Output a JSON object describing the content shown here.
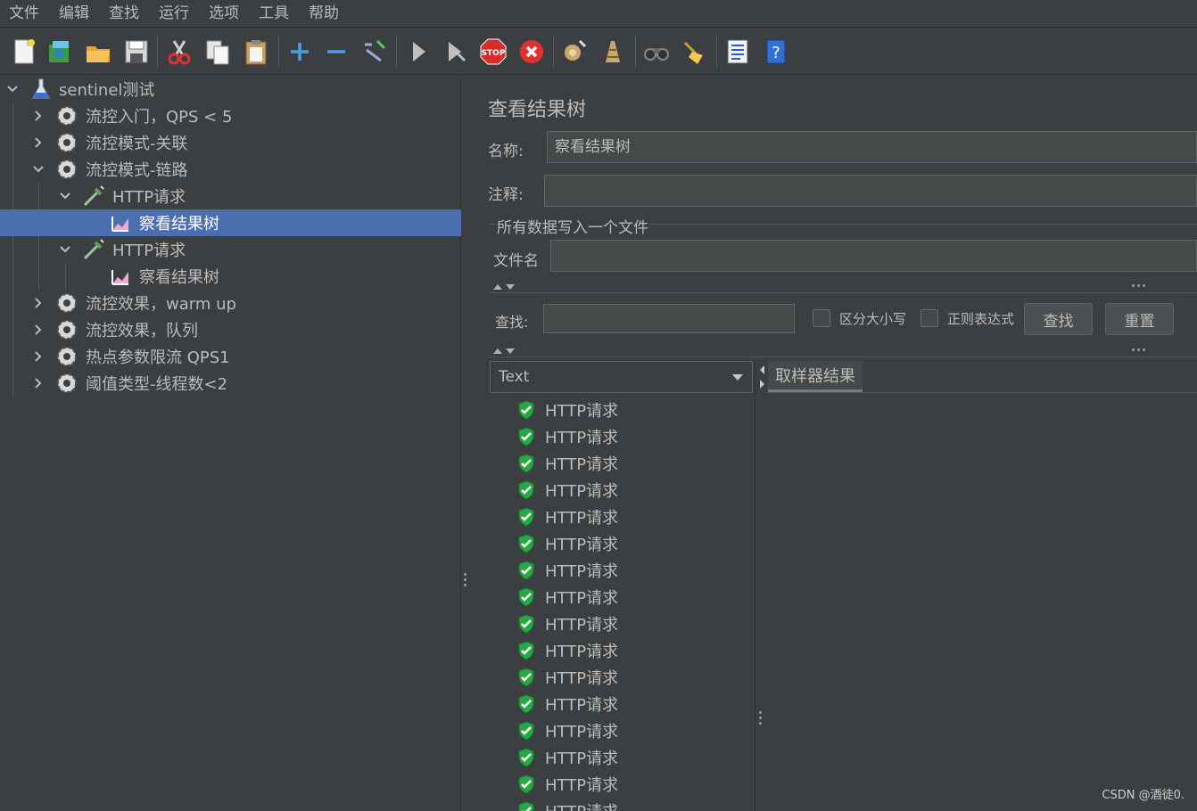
{
  "menubar": {
    "items": [
      "文件",
      "编辑",
      "查找",
      "运行",
      "选项",
      "工具",
      "帮助"
    ]
  },
  "toolbar": {
    "buttons": [
      "new-icon",
      "templates-icon",
      "open-icon",
      "save-icon",
      "cut-icon",
      "copy-icon",
      "paste-icon",
      "expand-icon",
      "collapse-icon",
      "toggle-icon",
      "start-icon",
      "start-no-pauses-icon",
      "stop-icon",
      "shutdown-icon",
      "clear-icon",
      "clear-all-icon",
      "search-icon",
      "reset-search-icon",
      "function-helper-icon",
      "help-icon"
    ]
  },
  "tree": {
    "items": [
      {
        "label": "sentinel测试",
        "icon": "test-plan-icon",
        "expanded": true
      },
      {
        "label": "流控入门，QPS < 5",
        "icon": "thread-group-icon",
        "expanded": false
      },
      {
        "label": "流控模式-关联",
        "icon": "thread-group-icon",
        "expanded": false
      },
      {
        "label": "流控模式-链路",
        "icon": "thread-group-icon",
        "expanded": true
      },
      {
        "label": "HTTP请求",
        "icon": "http-sampler-icon",
        "expanded": true
      },
      {
        "label": "察看结果树",
        "icon": "listener-icon",
        "selected": true
      },
      {
        "label": "HTTP请求",
        "icon": "http-sampler-icon",
        "expanded": true
      },
      {
        "label": "察看结果树",
        "icon": "listener-icon"
      },
      {
        "label": "流控效果，warm up",
        "icon": "thread-group-icon",
        "expanded": false
      },
      {
        "label": "流控效果，队列",
        "icon": "thread-group-icon",
        "expanded": false
      },
      {
        "label": "热点参数限流 QPS1",
        "icon": "thread-group-icon",
        "expanded": false
      },
      {
        "label": "阈值类型-线程数<2",
        "icon": "thread-group-icon",
        "expanded": false
      }
    ]
  },
  "panel": {
    "title": "查看结果树",
    "name_label": "名称:",
    "name_value": "察看结果树",
    "comment_label": "注释:",
    "comment_value": "",
    "file_section_title": "所有数据写入一个文件",
    "filename_label": "文件名",
    "filename_value": "",
    "search_label": "查找:",
    "search_value": "",
    "case_sensitive_label": "区分大小写",
    "regex_label": "正则表达式",
    "find_button": "查找",
    "reset_button": "重置",
    "renderer_selected": "Text",
    "sampler_tab": "取样器结果"
  },
  "results": {
    "items": [
      "HTTP请求",
      "HTTP请求",
      "HTTP请求",
      "HTTP请求",
      "HTTP请求",
      "HTTP请求",
      "HTTP请求",
      "HTTP请求",
      "HTTP请求",
      "HTTP请求",
      "HTTP请求",
      "HTTP请求",
      "HTTP请求",
      "HTTP请求",
      "HTTP请求",
      "HTTP请求"
    ],
    "status_icon": "success-shield-icon"
  },
  "watermark": "CSDN @酒徒0."
}
